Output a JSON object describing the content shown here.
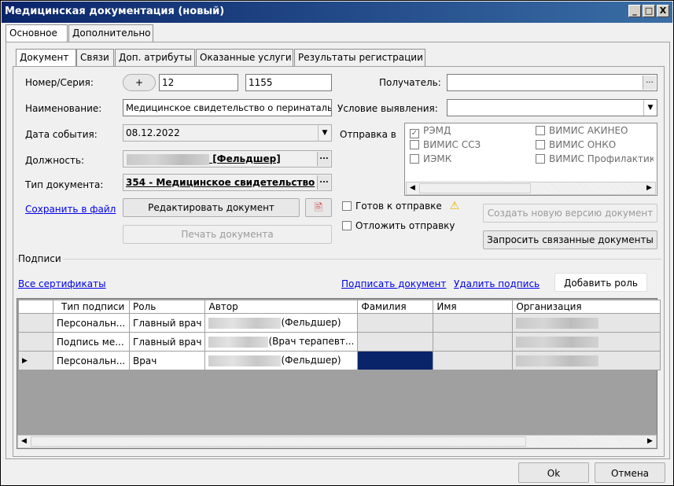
{
  "window": {
    "title": "Медицинская документация (новый)"
  },
  "main_tabs": [
    "Основное",
    "Дополнительно"
  ],
  "sub_tabs": [
    "Документ",
    "Связи",
    "Доп. атрибуты",
    "Оказанные услуги",
    "Результаты регистрации"
  ],
  "form": {
    "number_label": "Номер/Серия:",
    "plus_label": "+",
    "number": "12",
    "series": "1155",
    "name_label": "Наименование:",
    "name_value": "Медицинское свидетельство о перинатальн",
    "date_label": "Дата события:",
    "date_value": "08.12.2022",
    "position_label": "Должность:",
    "position_value": "[Фельдшер]",
    "doctype_label": "Тип документа:",
    "doctype_value": "354 - Медицинское свидетельство",
    "ellipsis": "...",
    "recipient_label": "Получатель:",
    "recipient_value": "",
    "condition_label": "Условие выявления:",
    "condition_value": "",
    "send_to_label": "Отправка в"
  },
  "send_targets": [
    {
      "label": "РЭМД",
      "checked": true
    },
    {
      "label": "ВИМИС АКИНЕО",
      "checked": false
    },
    {
      "label": "ВИМИС ССЗ",
      "checked": false
    },
    {
      "label": "ВИМИС ОНКО",
      "checked": false
    },
    {
      "label": "ИЭМК",
      "checked": false
    },
    {
      "label": "ВИМИС Профилактика",
      "checked": false
    }
  ],
  "actions": {
    "save_to_file": "Сохранить в файл",
    "edit_document": "Редактировать документ",
    "print_document": "Печать документа",
    "ready_to_send": "Готов к отправке",
    "postpone_send": "Отложить отправку",
    "create_new_version": "Создать новую версию документ",
    "request_related": "Запросить связанные документы"
  },
  "signatures": {
    "group_label": "Подписи",
    "all_certificates": "Все сертификаты",
    "sign_document": "Подписать документ",
    "delete_signature": "Удалить подпись",
    "add_role": "Добавить роль",
    "columns": [
      "Тип подписи",
      "Роль",
      "Автор",
      "Фамилия",
      "Имя",
      "Организация"
    ],
    "rows": [
      {
        "type": "Персональн...",
        "role": "Главный врач",
        "author_suffix": "(Фельдшер)"
      },
      {
        "type": "Подпись ме...",
        "role": "Главный врач",
        "author_suffix": "(Врач терапевт..."
      },
      {
        "type": "Персональн...",
        "role": "Врач",
        "author_suffix": "(Фельдшер)"
      }
    ]
  },
  "footer": {
    "ok": "Ok",
    "cancel": "Отмена"
  },
  "window_buttons": [
    "_",
    "□",
    "X"
  ]
}
